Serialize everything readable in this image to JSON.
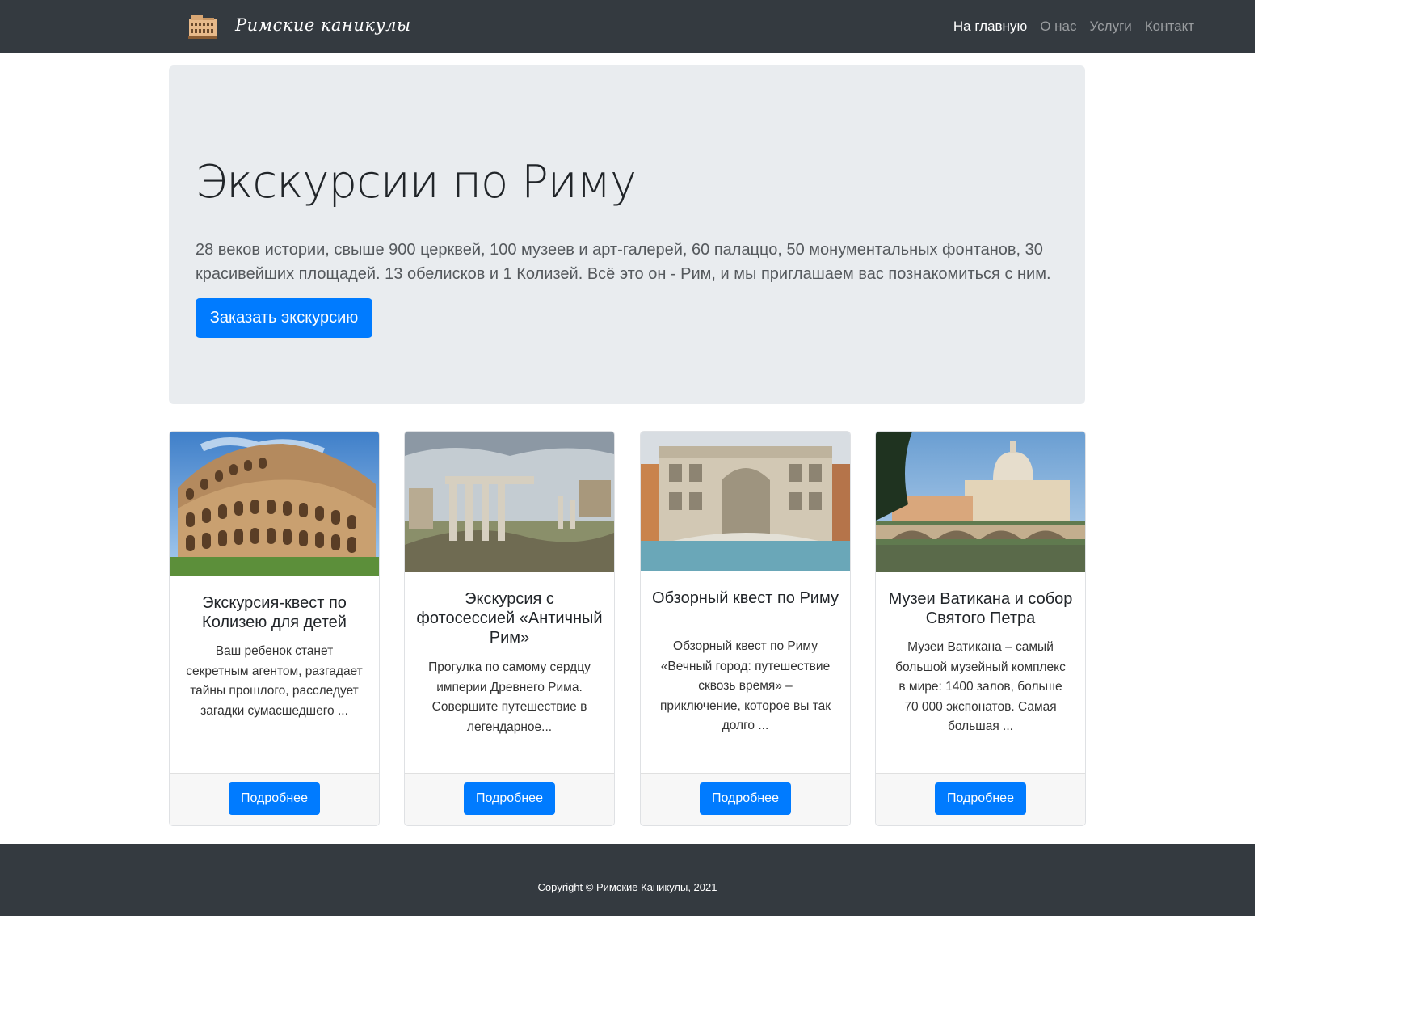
{
  "navbar": {
    "brand": "Римские каникулы",
    "links": [
      "На главную",
      "О нас",
      "Услуги",
      "Контакт"
    ]
  },
  "hero": {
    "title": "Экскурсии по Риму",
    "text": "28 веков истории, свыше 900 церквей, 100 музеев и арт-галерей, 60 палаццо, 50 монументальных фонтанов, 30 красивейших площадей. 13 обелисков и 1 Колизей. Всё это он - Рим, и мы приглашаем вас познакомиться с ним.",
    "button": "Заказать экскурсию"
  },
  "cards": [
    {
      "title": "Экскурсия-квест по Колизею для детей",
      "text": "Ваш ребенок станет секретным агентом, разгадает тайны прошлого, расследует загадки сумасшедшего ...",
      "button": "Подробнее"
    },
    {
      "title": "Экскурсия с фотосессией «Античный Рим»",
      "text": "Прогулка по самому сердцу империи Древнего Рима. Совершите путешествие в легендарное...",
      "button": "Подробнее"
    },
    {
      "title": "Обзорный квест по Риму",
      "text": "Обзорный квест по Риму «Вечный город: путешествие сквозь время» – приключение, которое вы так долго ...",
      "button": "Подробнее"
    },
    {
      "title": "Музеи Ватикана и собор Святого Петра",
      "text": "Музеи Ватикана – самый большой музейный комплекс в мире: 1400 залов, больше 70 000 экспонатов. Самая большая ...",
      "button": "Подробнее"
    }
  ],
  "footer": {
    "copyright": "Copyright © Римские Каникулы, 2021"
  },
  "colors": {
    "navbar": "#343a40",
    "primary": "#007bff",
    "jumbotron": "#e9ecef"
  }
}
